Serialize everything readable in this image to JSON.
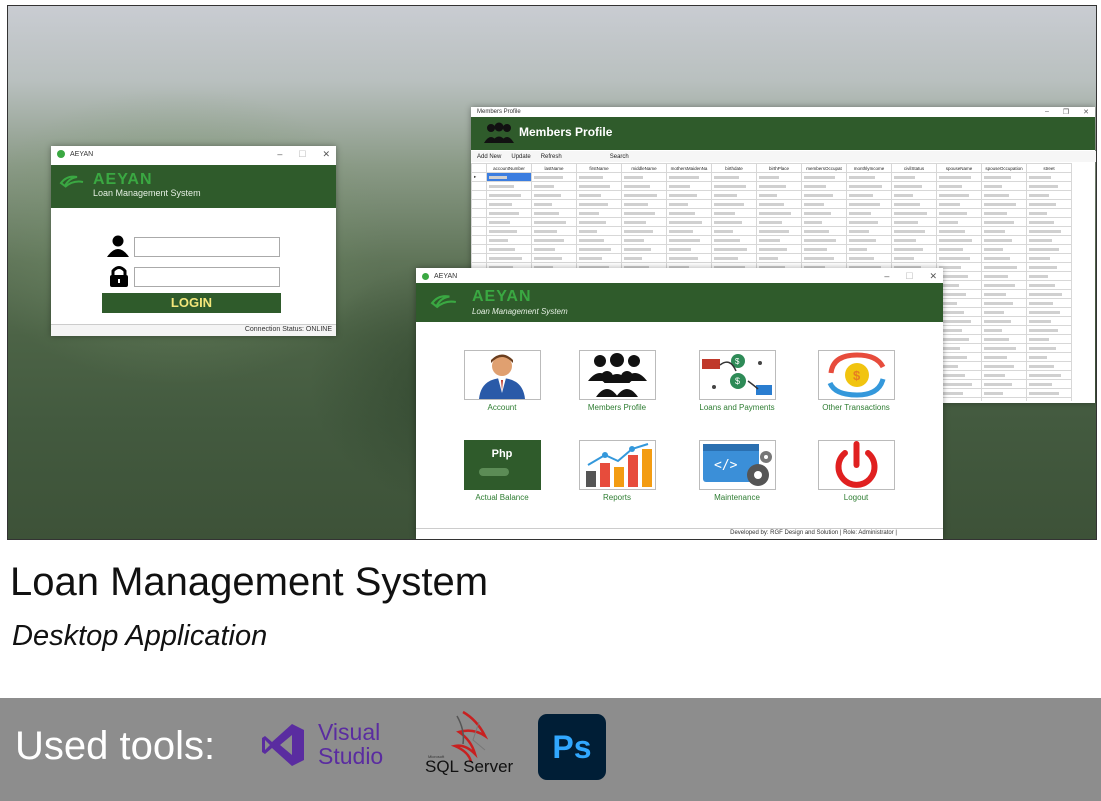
{
  "login_window": {
    "title": "AEYAN",
    "brand": "AEYAN",
    "brand_sub": "Loan Management System",
    "button_label": "LOGIN",
    "status": "Connection Status:  ONLINE"
  },
  "members_window": {
    "title": "Members Profile",
    "banner_title": "Members Profile",
    "toolbar": [
      "Add New",
      "Update",
      "Refresh",
      "Search"
    ],
    "columns": [
      "accountNumber",
      "lastName",
      "firstName",
      "middleName",
      "mothersMaidenNa",
      "birthdate",
      "birthPlace",
      "membersOccupat",
      "monthlyIncome",
      "civilStatus",
      "spouseName",
      "spouseOccupation",
      "street"
    ]
  },
  "dashboard_window": {
    "title": "AEYAN",
    "brand": "AEYAN",
    "brand_sub": "Loan Management System",
    "tiles": [
      {
        "label": "Account",
        "icon": "account-icon"
      },
      {
        "label": "Members Profile",
        "icon": "members-icon"
      },
      {
        "label": "Loans and Payments",
        "icon": "loans-icon"
      },
      {
        "label": "Other Transactions",
        "icon": "transactions-icon"
      },
      {
        "label": "Actual Balance",
        "icon": "balance-icon",
        "icon_text": "Php"
      },
      {
        "label": "Reports",
        "icon": "reports-icon"
      },
      {
        "label": "Maintenance",
        "icon": "maintenance-icon"
      },
      {
        "label": "Logout",
        "icon": "logout-icon"
      }
    ],
    "status": "Developed by: RGF Design and Solution  |  Role:  Administrator  |"
  },
  "caption": {
    "title": "Loan Management System",
    "subtitle": "Desktop Application"
  },
  "tools": {
    "label": "Used tools:",
    "visual_studio_line1": "Visual",
    "visual_studio_line2": "Studio",
    "sql_small": "Microsoft",
    "sql_text": "SQL Server",
    "photoshop": "Ps"
  },
  "colors": {
    "brand_green": "#2f5b2b",
    "accent_green": "#3aa842",
    "tile_label": "#2e7d32",
    "vs_purple": "#5a2ca0",
    "ps_bg": "#001e36",
    "ps_fg": "#31a8ff",
    "footer_gray": "#8d8d8d"
  }
}
